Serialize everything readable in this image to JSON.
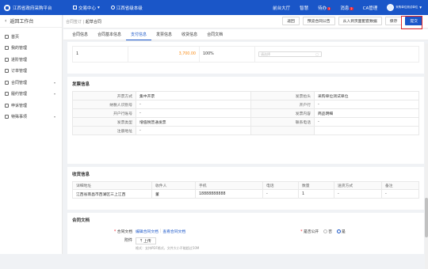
{
  "topbar": {
    "platform_title": "江西省政府采购平台",
    "menu": [
      "交易中心",
      "江西省级本级"
    ],
    "right": [
      "前台大厅",
      "智慧",
      "待办",
      "消息",
      "CA管理"
    ],
    "todo_badge": "1",
    "msg_badge": "2",
    "username": "采购单位测试单位"
  },
  "sidebar": {
    "back_label": "返回工作台",
    "items": [
      {
        "label": "首页",
        "has_children": false
      },
      {
        "label": "我的管理",
        "has_children": false
      },
      {
        "label": "进阶管理",
        "has_children": false
      },
      {
        "label": "订单管理",
        "has_children": false
      },
      {
        "label": "合同管理",
        "has_children": true
      },
      {
        "label": "履约管理",
        "has_children": true
      },
      {
        "label": "申诉管理",
        "has_children": false
      },
      {
        "label": "特殊事项",
        "has_children": true
      }
    ]
  },
  "breadcrumb": {
    "parent": "合同签订",
    "sep": "|",
    "current": "起草合同"
  },
  "actions": {
    "back": "返回",
    "preview": "预览合同公告",
    "import": "从入到页面配套数据",
    "save": "保存",
    "submit": "提交"
  },
  "tabs": [
    "合同信息",
    "合同基本信息",
    "支付信息",
    "发票信息",
    "收货信息",
    "合同文档"
  ],
  "active_tab": 2,
  "payment": {
    "row_no": "1",
    "amount": "3,700.00",
    "percent": "100%",
    "date_placeholder": "请选择"
  },
  "invoice": {
    "title": "发票信息",
    "rows": [
      {
        "k1": "开票方式",
        "v1": "集中开票",
        "k2": "发票抬头",
        "v2": "采购单位测试单位"
      },
      {
        "k1": "纳税人识别号",
        "v1": "-",
        "k2": "开户行",
        "v2": "-"
      },
      {
        "k1": "开户行账号",
        "v1": "-",
        "k2": "发票内容",
        "v2": "商品明细"
      },
      {
        "k1": "发票类型",
        "v1": "增值税普通发票",
        "k2": "联系电话",
        "v2": "-"
      },
      {
        "k1": "注册地址",
        "v1": "-",
        "k2": "",
        "v2": ""
      }
    ]
  },
  "receive": {
    "title": "收货信息",
    "headers": [
      "详细地址",
      "收件人",
      "手机",
      "电话",
      "数量",
      "送货方式",
      "备注"
    ],
    "rows": [
      [
        "江西省南昌市西湖区三上江西",
        "董",
        "18888888888",
        "-",
        "1",
        "-",
        "-"
      ]
    ]
  },
  "contract_doc": {
    "title": "合同文档",
    "doc_label": "合同文档",
    "edit_link": "编辑合同文档",
    "view_link": "查看合同文档",
    "public_label": "是否公开",
    "opt_no": "否",
    "opt_yes": "是",
    "selected": "是",
    "attach_label": "附件",
    "upload_label": "上传",
    "tip": "格式：支持PDF格式，文件大小不能超过50M"
  },
  "colors": {
    "primary": "#1a56c8",
    "highlight": "#e0262b"
  }
}
